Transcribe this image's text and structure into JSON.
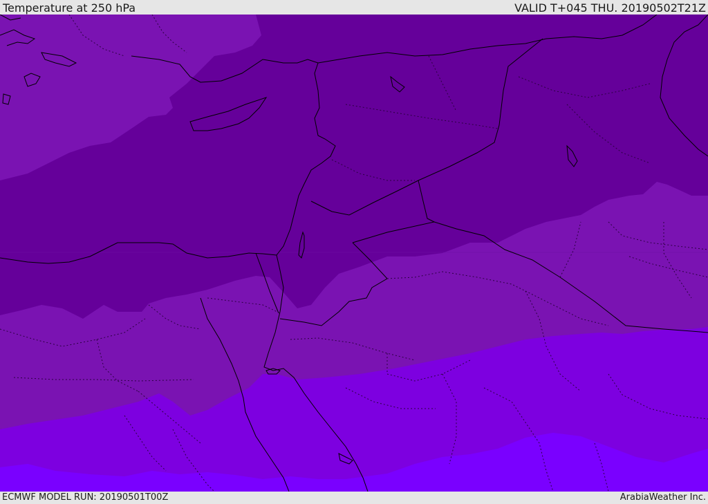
{
  "header": {
    "title": "Temperature at 250 hPa",
    "valid_time": "VALID T+045 THU. 20190502T21Z"
  },
  "footer": {
    "model_run": "ECMWF MODEL RUN: 20190501T00Z",
    "credit": "ArabiaWeather Inc."
  },
  "map": {
    "colors": {
      "band_lightest": "#7a00ff",
      "band_light": "#7d00e0",
      "band_mid": "#7a13b2",
      "band_dark": "#65009a",
      "coastline": "#000000",
      "border": "#000000"
    }
  }
}
